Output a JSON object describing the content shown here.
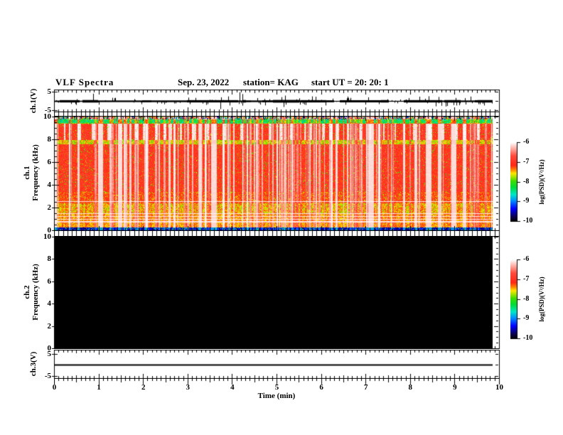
{
  "header": {
    "title": "VLF Spectra",
    "date": "Sep. 23, 2022",
    "station": "station= KAG",
    "start_ut": "start UT  =  20: 20: 1"
  },
  "chart_data": {
    "type": "heatmap",
    "title": "VLF Spectra",
    "date": "Sep. 23, 2022",
    "station": "KAG",
    "start_ut": "20: 20: 1",
    "x_axis": {
      "label": "Time (min)",
      "min": 0,
      "max": 10,
      "major_tick_labels": [
        "0",
        "1",
        "2",
        "3",
        "4",
        "5",
        "6",
        "7",
        "8",
        "9",
        "10"
      ],
      "minor_tick_step_min": 0.1,
      "data_end_min": 9.85
    },
    "panels": [
      {
        "id": "ch1_waveform",
        "ylabel": "ch.1(V)",
        "ymin": -6.2,
        "ymax": 6.2,
        "ytick_values": [
          5,
          -5
        ],
        "ytick_labels": [
          "5",
          "-5"
        ],
        "signal": "broadband noise centered on 0 V with frequent impulsive spikes",
        "baseline_noise_v": 0.4,
        "notable_spikes": [
          {
            "t_min": 0.86,
            "v": 4.2
          },
          {
            "t_min": 1.95,
            "v": -1.6
          },
          {
            "t_min": 3.72,
            "v": -4.3
          },
          {
            "t_min": 4.15,
            "v": 5.0
          },
          {
            "t_min": 4.22,
            "v": 4.0
          },
          {
            "t_min": 4.55,
            "v": 1.8
          },
          {
            "t_min": 5.6,
            "v": -1.8
          },
          {
            "t_min": 7.05,
            "v": 2.2
          },
          {
            "t_min": 7.95,
            "v": 1.8
          },
          {
            "t_min": 8.62,
            "v": 2.4
          },
          {
            "t_min": 9.35,
            "v": 2.6
          }
        ]
      },
      {
        "id": "ch1_spectrogram",
        "ylabel_lines": [
          "ch.1",
          "Frequency (kHz)"
        ],
        "ymin_khz": 0,
        "ymax_khz": 10,
        "ytick_values_khz": [
          10,
          8,
          6,
          4,
          2,
          0
        ],
        "ytick_labels": [
          "10",
          "8",
          "6",
          "4",
          "2",
          "0"
        ],
        "features": {
          "background_log_psd": -6.9,
          "dropout_columns": "frequent narrow white columns (log PSD near -6) cutting through 0.3-9.7 kHz",
          "bands": [
            {
              "range_khz": [
                9.78,
                10.0
              ],
              "appearance": "random multicolour specks, log PSD -10 to -6"
            },
            {
              "range_khz": [
                9.42,
                9.78
              ],
              "log_psd": -8.4,
              "appearance": "green-cyan band"
            },
            {
              "range_khz": [
                7.97,
                9.42
              ],
              "log_psd": -7.0,
              "appearance": "intense red blobs separated by white gaps"
            },
            {
              "range_khz": [
                7.6,
                7.97
              ],
              "log_psd": -7.7,
              "appearance": "yellow-green band"
            },
            {
              "range_khz": [
                3.4,
                7.6
              ],
              "log_psd": -7.0,
              "appearance": "red with pink-white dropout streaks"
            },
            {
              "range_khz": [
                2.42,
                3.4
              ],
              "log_psd": -7.1,
              "appearance": "deeper red with yellow flecks"
            },
            {
              "range_khz": [
                1.55,
                2.42
              ],
              "log_psd": -7.55,
              "appearance": "dense yellow-green band"
            },
            {
              "range_khz": [
                0.3,
                1.55
              ],
              "log_psd": -7.3,
              "appearance": "red-yellow mottle with thin white horizontal lines"
            },
            {
              "range_khz": [
                0.0,
                0.3
              ],
              "log_psd": -9.8,
              "appearance": "near-black strip with green/cyan specks"
            }
          ],
          "white_horizontal_lines_khz": [
            0.78,
            1.0,
            1.25,
            1.5,
            2.55
          ]
        }
      },
      {
        "id": "ch2_spectrogram",
        "ylabel_lines": [
          "ch.2",
          "Frequency (kHz)"
        ],
        "ymin_khz": 0,
        "ymax_khz": 10,
        "ytick_values_khz": [
          10,
          8,
          6,
          4,
          2,
          0
        ],
        "ytick_labels": [
          "10",
          "8",
          "6",
          "4",
          "2",
          "0"
        ],
        "features": {
          "background_log_psd": -10,
          "appearance": "uniform black, no signal"
        }
      },
      {
        "id": "ch3_waveform",
        "ylabel": "ch.3(V)",
        "ymin": -6.2,
        "ymax": 6.2,
        "ytick_values": [
          5,
          -5
        ],
        "ytick_labels": [
          "5",
          "-5"
        ],
        "signal": "constant 0 V flat line"
      }
    ],
    "colorbars": [
      {
        "label": "log(PSD)(V²/Hz)",
        "max": -6,
        "min": -10,
        "tick_labels": [
          "-6",
          "-7",
          "-8",
          "-9",
          "-10"
        ]
      },
      {
        "label": "log(PSD)(V²/Hz)",
        "max": -6,
        "min": -10,
        "tick_labels": [
          "-6",
          "-7",
          "-8",
          "-9",
          "-10"
        ]
      }
    ],
    "colormap_stops": [
      [
        0.0,
        "#000000"
      ],
      [
        0.06,
        "#0a0050"
      ],
      [
        0.16,
        "#0000ff"
      ],
      [
        0.26,
        "#008cff"
      ],
      [
        0.34,
        "#00e6c8"
      ],
      [
        0.43,
        "#00dc3c"
      ],
      [
        0.51,
        "#3cdc00"
      ],
      [
        0.57,
        "#b4e600"
      ],
      [
        0.61,
        "#ffe600"
      ],
      [
        0.65,
        "#ff8c00"
      ],
      [
        0.71,
        "#ff2814"
      ],
      [
        0.83,
        "#ff4a3c"
      ],
      [
        0.91,
        "#ffa096"
      ],
      [
        1.0,
        "#ffffff"
      ]
    ]
  }
}
